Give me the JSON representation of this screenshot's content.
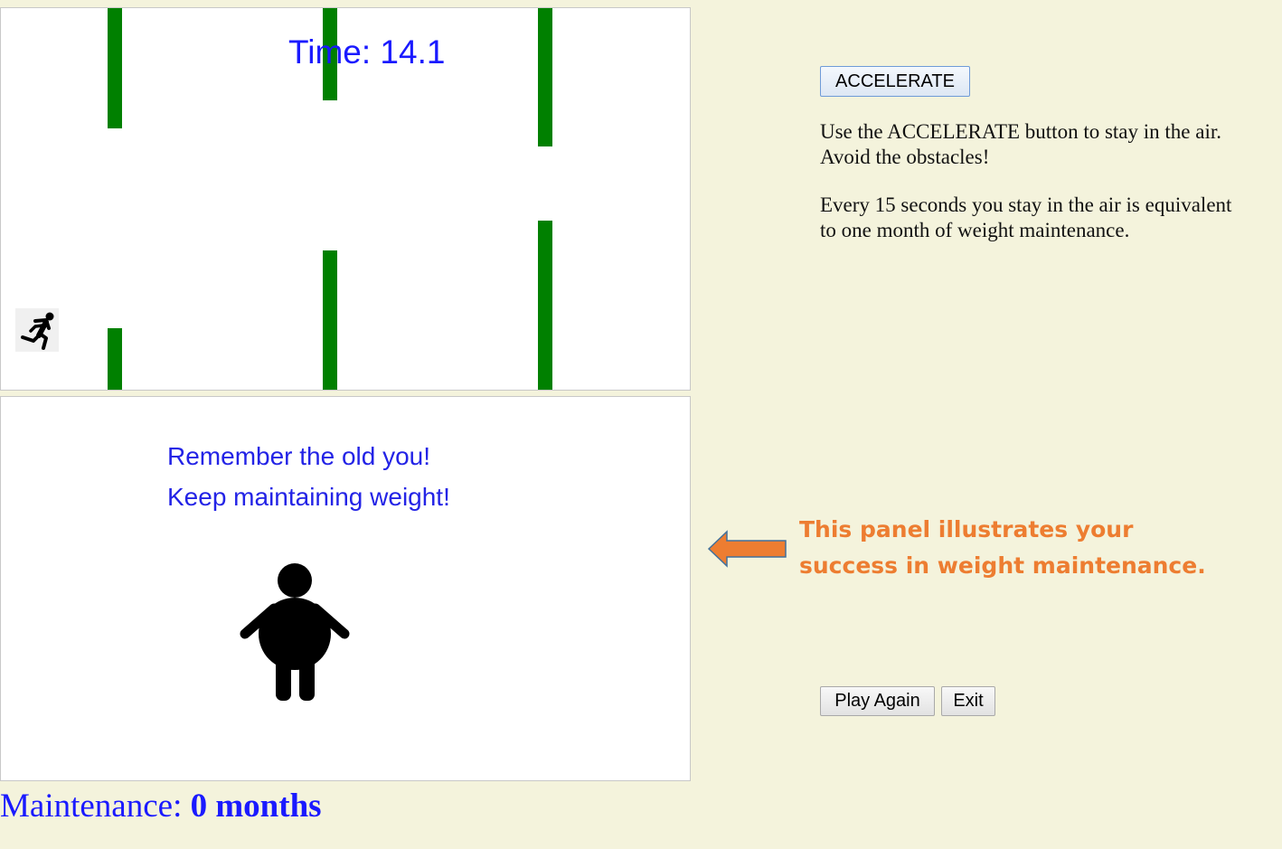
{
  "game": {
    "time_label": "Time: ",
    "time_value": "14.1"
  },
  "weight_panel": {
    "line1": "Remember the old you!",
    "line2": "Keep maintaining weight!"
  },
  "maintenance": {
    "label": "Maintenance: ",
    "value": "0 months"
  },
  "controls": {
    "accelerate_label": "ACCELERATE",
    "play_again_label": "Play Again",
    "exit_label": "Exit"
  },
  "instructions": {
    "paragraph1": "Use the ACCELERATE button to stay in the air. Avoid the obstacles!",
    "paragraph2": "Every 15 seconds you stay in the air is equivalent to one month of weight maintenance."
  },
  "annotation": {
    "text": "This panel illustrates your success in weight maintenance."
  },
  "colors": {
    "obstacle": "#008000",
    "time_text": "#1a1aff",
    "message_text": "#2323e6",
    "annotation": "#ed7d31",
    "background": "#f4f3dc"
  },
  "icons": {
    "player": "running-person-icon",
    "body": "overweight-person-icon",
    "annotation_arrow": "left-arrow-icon"
  }
}
